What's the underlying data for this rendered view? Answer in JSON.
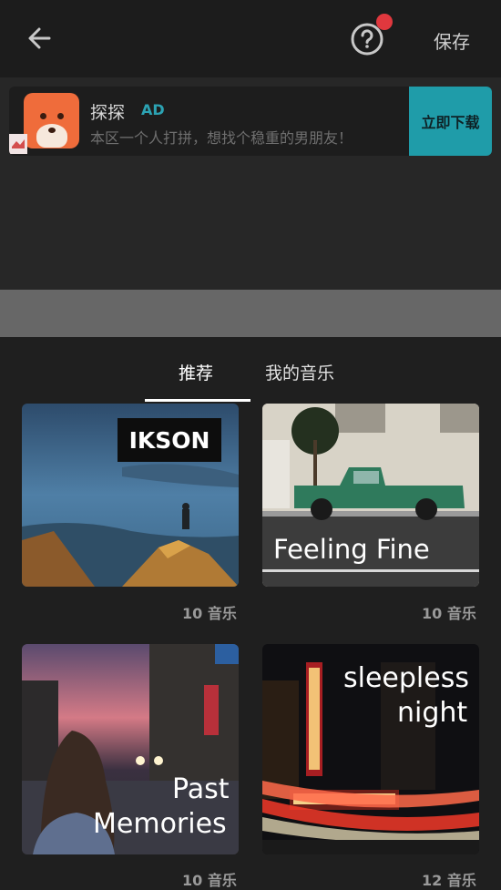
{
  "header": {
    "save_label": "保存"
  },
  "ad": {
    "title": "探探",
    "tag": "AD",
    "description": "本区一个人打拼，想找个稳重的男朋友！",
    "download_label": "立即下载"
  },
  "tabs": [
    {
      "label": "推荐"
    },
    {
      "label": "我的音乐"
    }
  ],
  "playlists": [
    {
      "title": "IKSON",
      "count": "10 音乐"
    },
    {
      "title": "Feeling Fine",
      "count": "10 音乐"
    },
    {
      "title_line1": "Past",
      "title_line2": "Memories",
      "count": "10 音乐"
    },
    {
      "title_line1": "sleepless",
      "title_line2": "night",
      "count": "12 音乐"
    }
  ],
  "colors": {
    "accent_ad": "#1f9ca9",
    "notification_dot": "#e0383e"
  }
}
